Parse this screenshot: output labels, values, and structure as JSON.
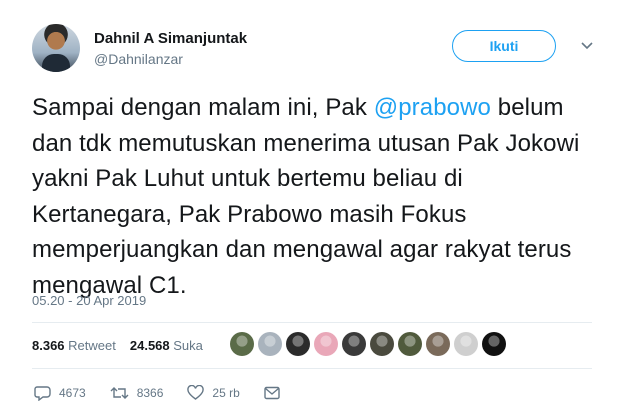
{
  "user": {
    "display_name": "Dahnil A Simanjuntak",
    "handle": "@Dahnilanzar",
    "follow_label": "Ikuti"
  },
  "tweet": {
    "text_before_mention": "Sampai dengan malam ini, Pak ",
    "mention": "@prabowo",
    "text_after_mention": " belum dan tdk memutuskan menerima utusan Pak Jokowi yakni Pak Luhut untuk bertemu beliau di Kertanegara, Pak Prabowo masih Fokus memperjuangkan dan mengawal agar rakyat terus mengawal C1.",
    "timestamp": "05.20 - 20 Apr 2019"
  },
  "stats": {
    "retweet_count": "8.366",
    "retweet_label": "Retweet",
    "like_count": "24.568",
    "like_label": "Suka"
  },
  "likers": [
    {
      "icon": "liker-avatar-1",
      "color": "#5a6b48"
    },
    {
      "icon": "liker-avatar-2",
      "color": "#a9b3bd"
    },
    {
      "icon": "liker-avatar-3",
      "color": "#2b2b2b"
    },
    {
      "icon": "liker-avatar-4",
      "color": "#e9a7b8"
    },
    {
      "icon": "liker-avatar-5",
      "color": "#3a3a3a"
    },
    {
      "icon": "liker-avatar-6",
      "color": "#4a4a3e"
    },
    {
      "icon": "liker-avatar-7",
      "color": "#505a3c"
    },
    {
      "icon": "liker-avatar-8",
      "color": "#7a6a5a"
    },
    {
      "icon": "liker-avatar-9",
      "color": "#cfcfcf"
    },
    {
      "icon": "liker-avatar-10",
      "color": "#111111"
    }
  ],
  "actions": {
    "reply_count": "4673",
    "retweet_count": "8366",
    "like_count": "25 rb"
  },
  "colors": {
    "accent": "#1da1f2",
    "secondary_text": "#657786",
    "divider": "#e6ecf0"
  }
}
